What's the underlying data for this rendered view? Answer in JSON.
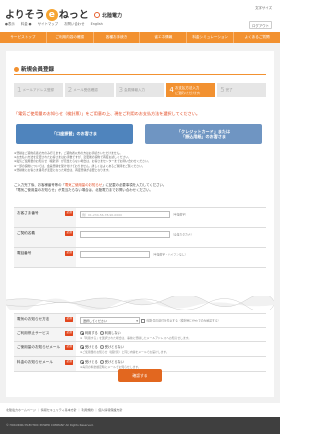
{
  "header": {
    "logo_text_a": "よりそう",
    "logo_e": "e",
    "logo_text_b": "ねっと",
    "logo_company": "北陸電力",
    "top_right": "文字サイズ",
    "login": "ログアウト",
    "subnav": [
      "●表示",
      "料金 ●",
      "サイトマップ",
      "お問い合わせ",
      "English"
    ]
  },
  "nav": {
    "items": [
      "サービストップ",
      "ご利用内容の確認",
      "各種お手続き",
      "省エネ情報",
      "料金シミュレーション",
      "よくあるご質問"
    ]
  },
  "page_title": "新規会員登録",
  "steps": [
    {
      "num": "1",
      "label": "メールアドレス登録"
    },
    {
      "num": "2",
      "label": "メール受信確認"
    },
    {
      "num": "3",
      "label": "会員情報入力"
    },
    {
      "num": "4",
      "label": "お支払方法入力",
      "sub": "(ご選択いただけます)"
    },
    {
      "num": "5",
      "label": "完了"
    }
  ],
  "notice_red": "「電気ご使用量のお知らせ（検針票）」をご用意の上、現在ご利用のお支払方法を選択してください。",
  "pay_buttons": {
    "left": "「口座振替」のお客さま",
    "right_line1": "「クレジットカード」または",
    "right_line2": "「振込用紙」のお客さま"
  },
  "notes": [
    "※登録はご契約名義の方のみ行えます。ご契約者以外の方はお手続きいただけません。",
    "※お支払い方法を変更されたお客さまはお手数ですが、変更後の契約で再度お試しください。",
    "※電気ご使用量のお知らせ（検針票）が見当たらない場合は、お客さまセンターまでお問い合わせください。",
    "※一部の契約については、会員登録を受け付けておりません。詳しくはよくあるご質問をご覧ください。",
    "※登録後にお客さま番号が変更になった場合は、再度登録が必要となります。"
  ],
  "intro": {
    "line1_a": "ご入力完了後、お客様番号等の「",
    "line1_hl": "電気ご使用量のお知らせ",
    "line1_b": "」に記載の必要事項を入力してください。",
    "line2": "「電気ご使用量のお知らせ」が見当たらない場合は、北陸電力までお問い合わせください。"
  },
  "form": {
    "required": "必須",
    "rows": [
      {
        "label": "お客さま番号",
        "value": "",
        "hint": "（半角数字）",
        "placeholder": "例）01-234-56-78-90-0000"
      },
      {
        "label": "ご契約名義",
        "value": "",
        "hint": "（全角カタカナ）"
      },
      {
        "label": "電話番号",
        "value": "",
        "hint": "（半角数字・ハイフンなし）"
      },
      {
        "label": "検針日",
        "value": "",
        "hint": "（例：毎月○日）"
      }
    ],
    "notify_label": "電気のお知らせ方法",
    "notify_select": "選択してください",
    "notify_check": "(検針票の送付を停止する（検針時にWebでのみ確認する）",
    "notify_note": "※検針票の送付停止を希望される方は、チェックしてください。",
    "service_label": "ご利用停止サービス",
    "service_opt_a": "利用する",
    "service_opt_b": "利用しない",
    "service_note": "※「利用する」を選択された場合は、事前に登録したメールアドレスへお知らせします。",
    "mail_label": "ご使用量のお知らせメール",
    "mail_opt_a": "受けとる",
    "mail_opt_b": "受けとらない",
    "mail_note": "※ご使用量のお知らせ（検針票）と同じ内容をメールでお届けします。",
    "news_label": "料金のお知らせメール",
    "news_opt_a": "受けとる",
    "news_opt_b": "受けとらない",
    "news_note": "※毎月の料金確定時にメールでお知らせします。"
  },
  "confirm_button": "確認する",
  "footer": {
    "links": "北陸電力ホームページ ｜ 情報セキュリティ基本方針 ｜ 利用規約 ｜ 個人情報保護方針",
    "copyright": "© HOKURIKU ELECTRIC POWER COMPANY All Rights Reserved."
  },
  "colors": {
    "brand_orange": "#f29130",
    "accent_red": "#e2461d",
    "button_blue": "#4f84bd",
    "footer_dark": "#3f3f3f"
  }
}
